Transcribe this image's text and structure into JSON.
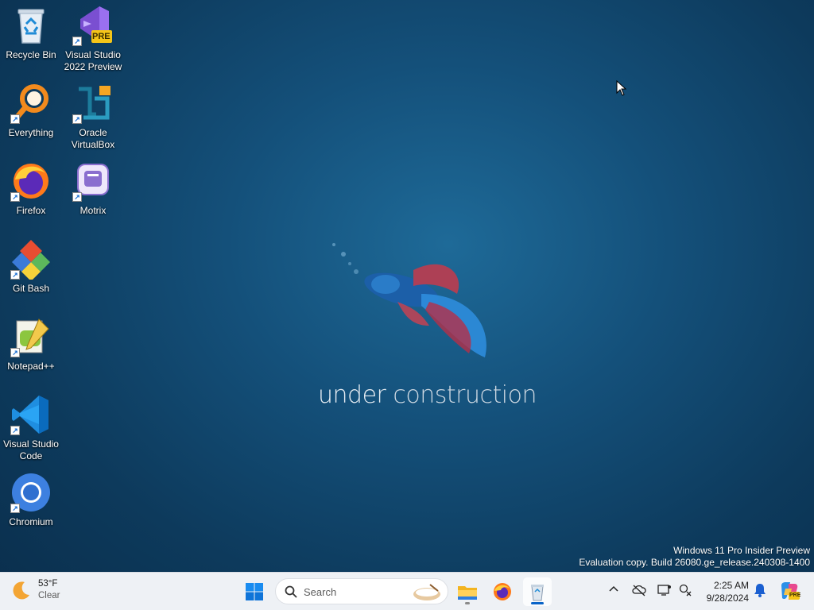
{
  "desktop": {
    "icons": [
      {
        "label": "Recycle Bin"
      },
      {
        "label": "Visual Studio 2022 Preview",
        "badge": "PRE"
      },
      {
        "label": "Everything"
      },
      {
        "label": "Oracle VirtualBox"
      },
      {
        "label": "Firefox"
      },
      {
        "label": "Motrix"
      },
      {
        "label": "Git Bash"
      },
      {
        "label": "Notepad++"
      },
      {
        "label": "Visual Studio Code"
      },
      {
        "label": "Chromium"
      }
    ],
    "wallpaper_text_1": "under",
    "wallpaper_text_2": " construction",
    "watermark_line1": "Windows 11 Pro Insider Preview",
    "watermark_line2": "Evaluation copy. Build 26080.ge_release.240308-1400"
  },
  "taskbar": {
    "weather_temp": "53°F",
    "weather_cond": "Clear",
    "search_placeholder": "Search",
    "clock_time": "2:25 AM",
    "clock_date": "9/28/2024",
    "copilot_badge": "PRE",
    "icons": [
      "start-icon",
      "search-icon",
      "file-explorer-icon",
      "firefox-icon",
      "recycle-app-icon",
      "chevron-up-icon",
      "onedrive-icon",
      "display-icon",
      "network-icon",
      "notification-bell-icon",
      "copilot-icon"
    ]
  },
  "colors": {
    "taskbar_bg": "#eef1f5",
    "accent": "#0a64c8"
  }
}
